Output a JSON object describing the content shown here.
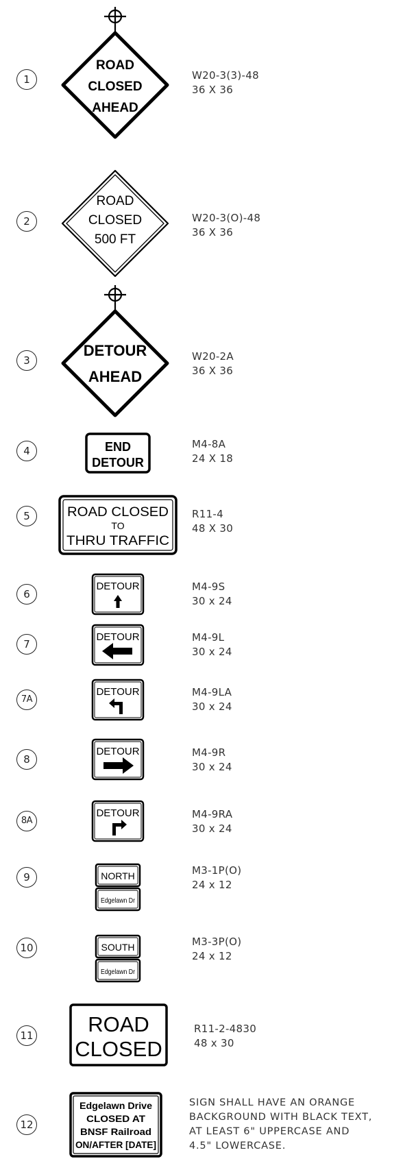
{
  "signs": [
    {
      "num": "1",
      "lines": [
        "ROAD",
        "CLOSED",
        "AHEAD"
      ],
      "code": "W20-3(3)-48",
      "size": "36 X 36"
    },
    {
      "num": "2",
      "lines": [
        "ROAD",
        "CLOSED",
        "500 FT"
      ],
      "code": "W20-3(O)-48",
      "size": "36 X 36"
    },
    {
      "num": "3",
      "lines": [
        "DETOUR",
        "AHEAD"
      ],
      "code": "W20-2A",
      "size": "36 X 36"
    },
    {
      "num": "4",
      "lines": [
        "END",
        "DETOUR"
      ],
      "code": "M4-8A",
      "size": "24 X 18"
    },
    {
      "num": "5",
      "lines": [
        "ROAD CLOSED",
        "TO",
        "THRU TRAFFIC"
      ],
      "code": "R11-4",
      "size": "48 X 30"
    },
    {
      "num": "6",
      "lines": [
        "DETOUR"
      ],
      "code": "M4-9S",
      "size": "30 x 24"
    },
    {
      "num": "7",
      "lines": [
        "DETOUR"
      ],
      "code": "M4-9L",
      "size": "30 x 24"
    },
    {
      "num": "7A",
      "lines": [
        "DETOUR"
      ],
      "code": "M4-9LA",
      "size": "30 x 24"
    },
    {
      "num": "8",
      "lines": [
        "DETOUR"
      ],
      "code": "M4-9R",
      "size": "30 x 24"
    },
    {
      "num": "8A",
      "lines": [
        "DETOUR"
      ],
      "code": "M4-9RA",
      "size": "30 x 24"
    },
    {
      "num": "9",
      "lines": [
        "NORTH",
        "Edgelawn Dr"
      ],
      "code": "M3-1P(O)",
      "size": "24 x 12"
    },
    {
      "num": "10",
      "lines": [
        "SOUTH",
        "Edgelawn Dr"
      ],
      "code": "M3-3P(O)",
      "size": "24 x 12"
    },
    {
      "num": "11",
      "lines": [
        "ROAD",
        "CLOSED"
      ],
      "code": "R11-2-4830",
      "size": "48 x 30"
    },
    {
      "num": "12",
      "lines": [
        "Edgelawn Drive",
        "CLOSED AT",
        "BNSF Railroad",
        "ON/AFTER [DATE]"
      ]
    }
  ],
  "note": {
    "lines": [
      "SIGN SHALL HAVE AN ORANGE",
      "BACKGROUND WITH BLACK TEXT,",
      "AT LEAST 6\" UPPERCASE AND",
      "4.5\" LOWERCASE."
    ]
  }
}
